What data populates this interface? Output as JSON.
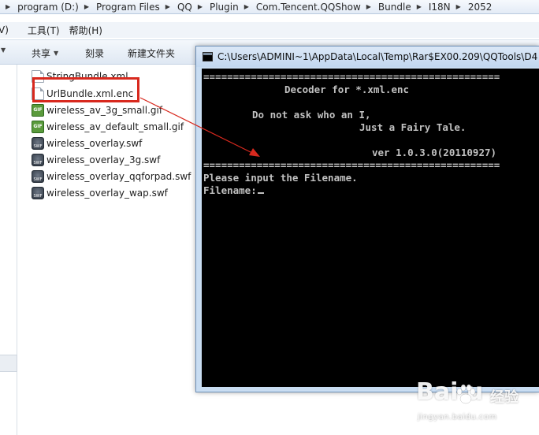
{
  "address_bar": {
    "crumbs": [
      "program (D:)",
      "Program Files",
      "QQ",
      "Plugin",
      "Com.Tencent.QQShow",
      "Bundle",
      "I18N",
      "2052"
    ]
  },
  "menu": {
    "items": [
      "V)",
      "工具(T)",
      "帮助(H)"
    ]
  },
  "toolbar": {
    "share_label": "共享",
    "burn_label": "刻录",
    "new_folder_label": "新建文件夹"
  },
  "files": [
    {
      "name": "StringBundle.xml",
      "icon": "xml-file-icon"
    },
    {
      "name": "UrlBundle.xml.enc",
      "icon": "file-icon"
    },
    {
      "name": "wireless_av_3g_small.gif",
      "icon": "gif-file-icon"
    },
    {
      "name": "wireless_av_default_small.gif",
      "icon": "gif-file-icon"
    },
    {
      "name": "wireless_overlay.swf",
      "icon": "swf-file-icon"
    },
    {
      "name": "wireless_overlay_3g.swf",
      "icon": "swf-file-icon"
    },
    {
      "name": "wireless_overlay_qqforpad.swf",
      "icon": "swf-file-icon"
    },
    {
      "name": "wireless_overlay_wap.swf",
      "icon": "swf-file-icon"
    }
  ],
  "console": {
    "title": "C:\\Users\\ADMINI~1\\AppData\\Local\\Temp\\Rar$EX00.209\\QQTools\\D4",
    "separator": "==================================================",
    "heading": "Decoder for *.xml.enc",
    "quote_line1": "Do not ask who an I,",
    "quote_line2": "Just a Fairy Tale.",
    "version": "ver 1.0.3.0(20110927)",
    "prompt": "Please input the Filename.",
    "input_label": "Filename:"
  },
  "watermark": {
    "brand": "Bai  u",
    "brand_cn": "经验",
    "url": "jingyan.baidu.com"
  },
  "colors": {
    "highlight": "#d8291e",
    "console_bg": "#000000",
    "console_text": "#c0c0c0"
  }
}
